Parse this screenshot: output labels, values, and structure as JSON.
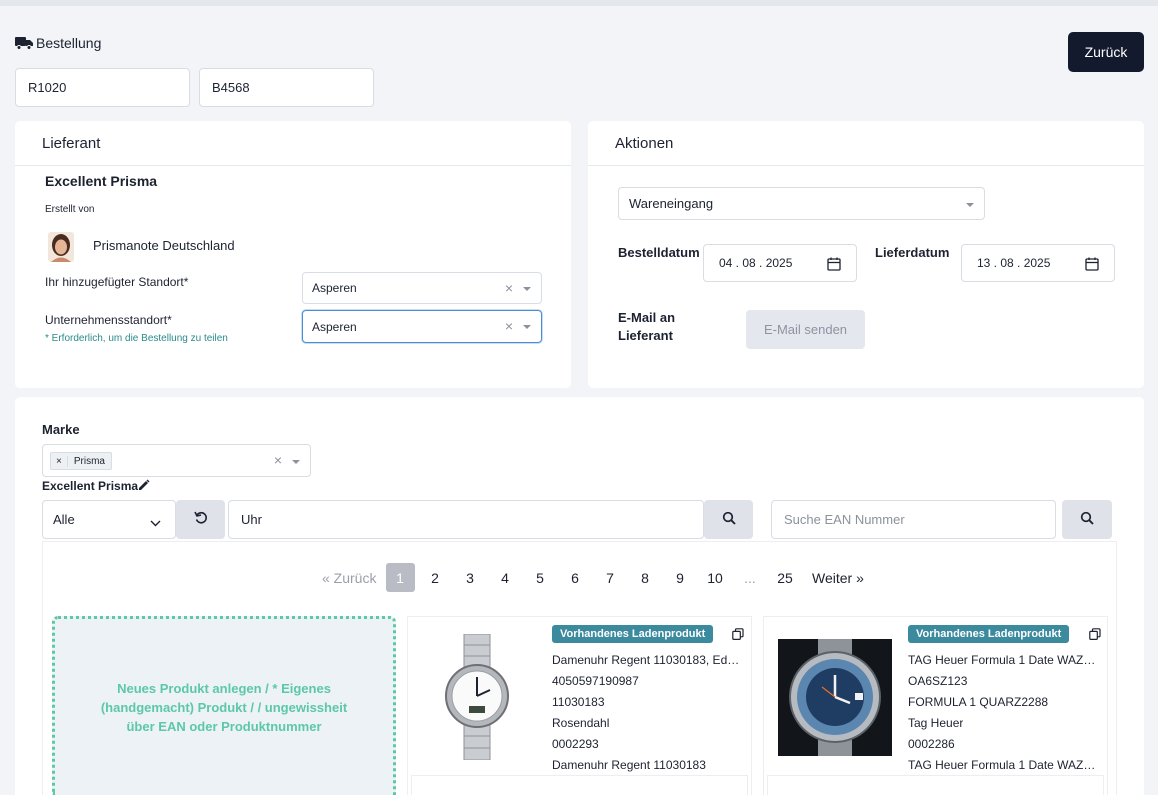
{
  "header": {
    "section_label": "Bestellung",
    "order_number_1": "R1020",
    "order_number_2": "B4568",
    "back_button": "Zurück"
  },
  "supplier_card": {
    "title": "Lieferant",
    "supplier_name": "Excellent Prisma",
    "created_by_label": "Erstellt von",
    "creator_name": "Prismanote Deutschland",
    "location_label": "Ihr hinzugefügter Standort*",
    "location_value": "Asperen",
    "company_location_label": "Unternehmensstandort*",
    "company_location_value": "Asperen",
    "required_hint": "* Erforderlich, um die Bestellung zu teilen"
  },
  "actions_card": {
    "title": "Aktionen",
    "action_select": "Wareneingang",
    "order_date_label": "Bestelldatum",
    "order_date": "04 . 08 . 2025",
    "delivery_date_label": "Lieferdatum",
    "delivery_date": "13 . 08 . 2025",
    "email_label_line1": "E-Mail an",
    "email_label_line2": "Lieferant",
    "email_button": "E-Mail senden"
  },
  "products_section": {
    "brand_label": "Marke",
    "brand_tag": "Prisma",
    "brand_tag_remove": "×",
    "supplier_heading": "Excellent Prisma",
    "filter_select": "Alle",
    "search_value": "Uhr",
    "ean_placeholder": "Suche EAN Nummer",
    "pagination": {
      "prev": "« Zurück",
      "pages": [
        "1",
        "2",
        "3",
        "4",
        "5",
        "6",
        "7",
        "8",
        "9",
        "10",
        "...",
        "25"
      ],
      "active": "1",
      "next": "Weiter »"
    },
    "new_product_text": "Neues Produkt anlegen / * Eigenes (handgemacht) Produkt / / ungewissheit über EAN oder Produktnummer",
    "products": [
      {
        "badge": "Vorhandenes Ladenprodukt",
        "name": "Damenuhr Regent 11030183, Edel...",
        "ean": "4050597190987",
        "article": "11030183",
        "brand": "Rosendahl",
        "code": "0002293",
        "description": "Damenuhr Regent 11030183"
      },
      {
        "badge": "Vorhandenes Ladenprodukt",
        "name": "TAG Heuer Formula 1 Date WAZ1...",
        "ean": "OA6SZ123",
        "article": "FORMULA 1 QUARZ2288",
        "brand": "Tag Heuer",
        "code": "0002286",
        "description": "TAG Heuer Formula 1 Date WAZ1..."
      }
    ]
  },
  "colors": {
    "dark_button": "#131a2e",
    "badge": "#3b8a9e",
    "new_product_border": "#5cc8a8",
    "new_product_text": "#5cc8a8",
    "hint_text": "#2b8a8a"
  }
}
